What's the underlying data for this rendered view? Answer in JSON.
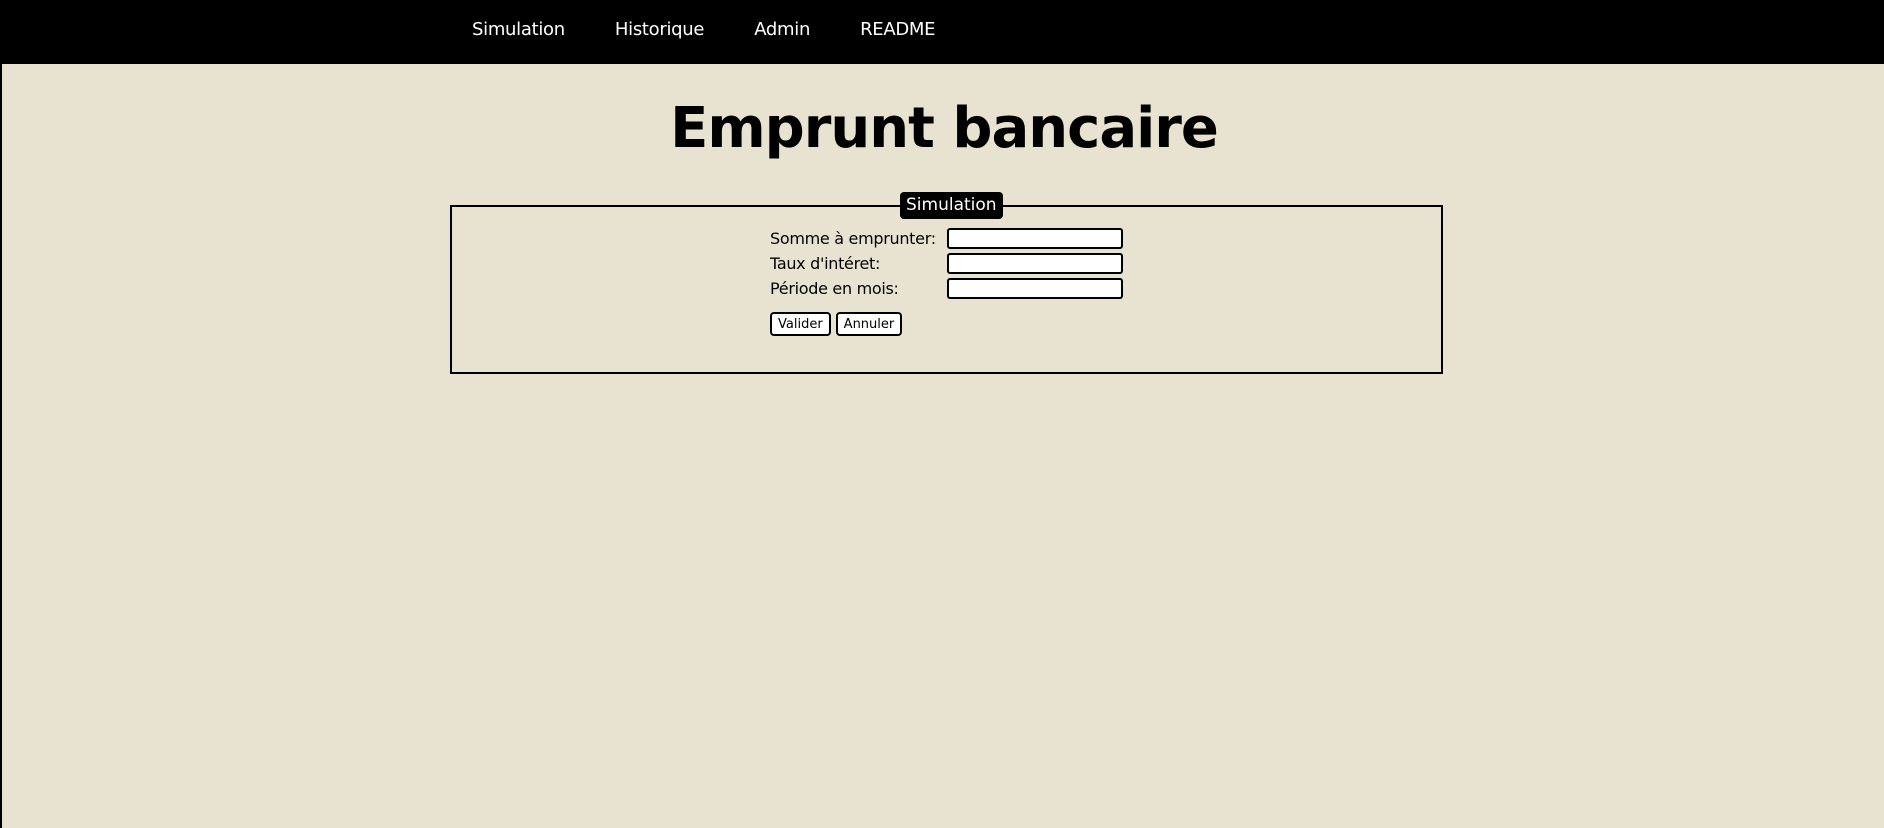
{
  "nav": {
    "items": [
      {
        "label": "Simulation"
      },
      {
        "label": "Historique"
      },
      {
        "label": "Admin"
      },
      {
        "label": "README"
      }
    ]
  },
  "page": {
    "title": "Emprunt bancaire"
  },
  "simulation": {
    "legend": "Simulation",
    "fields": {
      "amount": {
        "label": "Somme à emprunter:",
        "value": ""
      },
      "rate": {
        "label": "Taux d'intéret:",
        "value": ""
      },
      "period": {
        "label": "Période en mois:",
        "value": ""
      }
    },
    "buttons": {
      "submit": "Valider",
      "cancel": "Annuler"
    }
  },
  "colors": {
    "background": "#e8e3d1",
    "nav_background": "#000000",
    "nav_text": "#ffffff",
    "border": "#000000"
  }
}
